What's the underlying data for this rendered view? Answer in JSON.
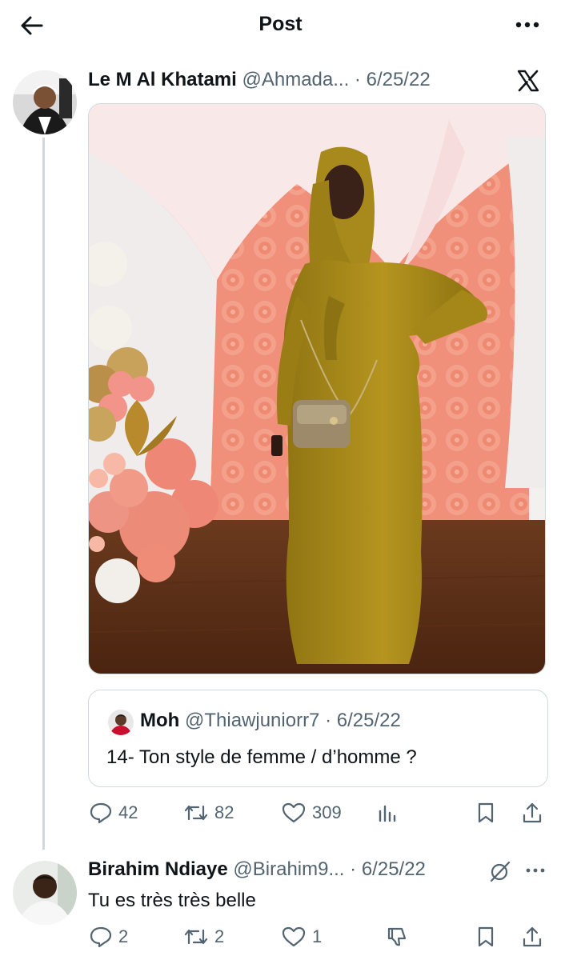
{
  "topbar": {
    "title": "Post"
  },
  "post": {
    "author_name": "Le M Al Khatami",
    "handle": "@Ahmada...",
    "dot": "·",
    "date": "6/25/22",
    "quote": {
      "author_name": "Moh",
      "handle": "@Thiawjuniorr7",
      "dot": "·",
      "date": "6/25/22",
      "text": "14- Ton style de femme / d’homme ?"
    },
    "stats": {
      "replies": "42",
      "reposts": "82",
      "likes": "309"
    }
  },
  "reply": {
    "author_name": "Birahim Ndiaye",
    "handle": "@Birahim9...",
    "dot": "·",
    "date": "6/25/22",
    "text": "Tu es très très belle",
    "stats": {
      "replies": "2",
      "reposts": "2",
      "likes": "1"
    }
  },
  "colors": {
    "text": "#0f1419",
    "secondary": "#536471",
    "border": "#cfd9de",
    "mustard": "#a88a1c",
    "backdrop": "#f0907a"
  }
}
